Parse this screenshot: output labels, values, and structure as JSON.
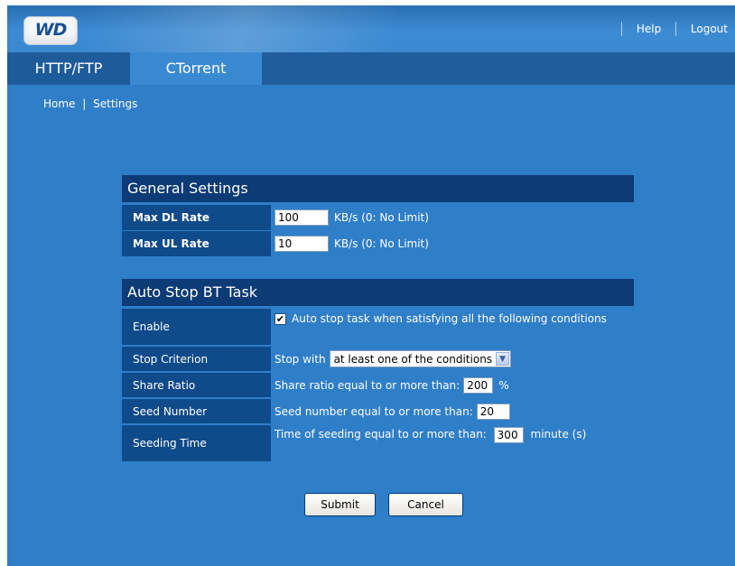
{
  "header": {
    "logo_text": "WD",
    "help_label": "Help",
    "logout_label": "Logout"
  },
  "tabs": [
    {
      "label": "HTTP/FTP",
      "active": false
    },
    {
      "label": "CTorrent",
      "active": true
    }
  ],
  "breadcrumb": {
    "home": "Home",
    "sep": "|",
    "current": "Settings"
  },
  "general": {
    "title": "General Settings",
    "max_dl": {
      "label": "Max DL Rate",
      "value": "100",
      "note": "KB/s  (0: No Limit)"
    },
    "max_ul": {
      "label": "Max UL Rate",
      "value": "10",
      "note": "KB/s  (0: No Limit)"
    }
  },
  "autostop": {
    "title": "Auto Stop BT Task",
    "enable": {
      "label": "Enable",
      "checked": true,
      "text": "Auto stop task when satisfying all the following conditions"
    },
    "criterion": {
      "label": "Stop Criterion",
      "prefix": "Stop with",
      "selected": "at least one of the conditions"
    },
    "share_ratio": {
      "label": "Share Ratio",
      "prefix": "Share ratio equal to or more than:",
      "value": "200",
      "unit": "%"
    },
    "seed_number": {
      "label": "Seed Number",
      "prefix": "Seed number equal to or more than:",
      "value": "20"
    },
    "seeding_time": {
      "label": "Seeding Time",
      "prefix": "Time of seeding equal to or more than:",
      "value": "300",
      "unit": "minute (s)"
    }
  },
  "buttons": {
    "submit": "Submit",
    "cancel": "Cancel"
  },
  "colors": {
    "page_bg": "#2f7ec8",
    "section_head": "#0c3b75",
    "label_bg": "#0f4a8a",
    "active_tab": "#3a8ad2"
  }
}
